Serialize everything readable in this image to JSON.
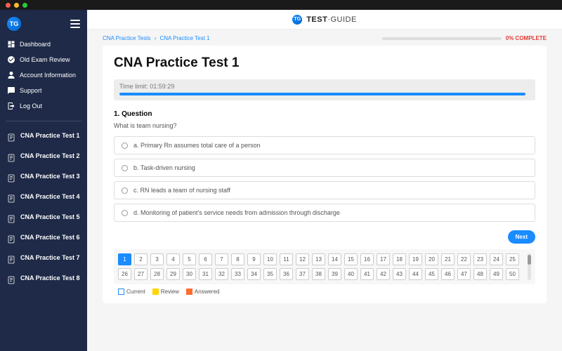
{
  "nav": {
    "items": [
      {
        "label": "Dashboard",
        "icon": "dashboard"
      },
      {
        "label": "Old Exam Review",
        "icon": "check"
      },
      {
        "label": "Account Information",
        "icon": "user"
      },
      {
        "label": "Support",
        "icon": "chat"
      },
      {
        "label": "Log Out",
        "icon": "logout"
      }
    ]
  },
  "tests": [
    "CNA Practice Test 1",
    "CNA Practice Test 2",
    "CNA Practice Test 3",
    "CNA Practice Test 4",
    "CNA Practice Test 5",
    "CNA Practice Test 6",
    "CNA Practice Test 7",
    "CNA Practice Test 8"
  ],
  "header": {
    "brand_bold": "TEST",
    "brand_light": "·GUIDE"
  },
  "breadcrumb": {
    "parent": "CNA Practice Tests",
    "current": "CNA Practice Test 1"
  },
  "progress": {
    "complete_label": "0% COMPLETE"
  },
  "page": {
    "title": "CNA Practice Test 1",
    "timer_label": "Time limit:",
    "timer_value": "01:59:29"
  },
  "question": {
    "number": "1.",
    "heading": "Question",
    "text": "What is team nursing?",
    "answers": [
      "a. Primary Rn assumes total care of a person",
      "b. Task-driven nursing",
      "c. RN leads a team of nursing staff",
      "d. Monitoring of patient's service needs from admission through discharge"
    ]
  },
  "buttons": {
    "next": "Next"
  },
  "nav_grid": {
    "total": 50,
    "current": 1
  },
  "legend": {
    "current": "Current",
    "review": "Review",
    "answered": "Answered"
  }
}
